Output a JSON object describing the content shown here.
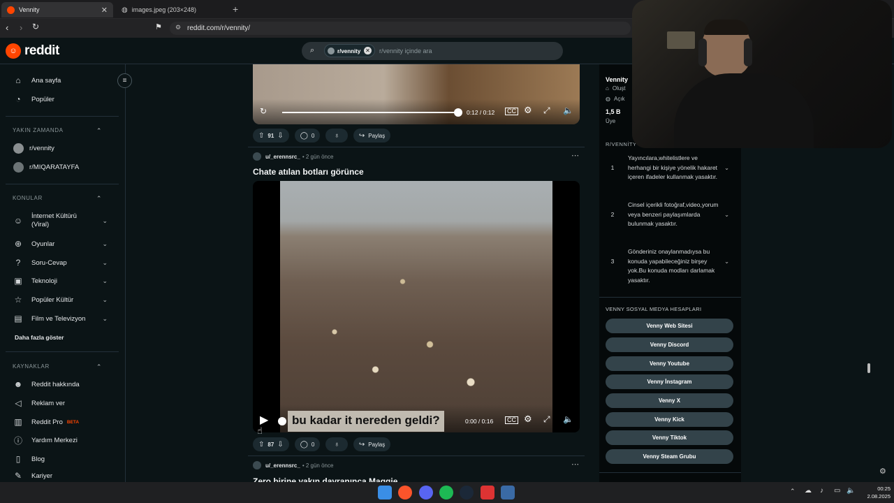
{
  "browser": {
    "tabs": [
      {
        "title": "Vennity",
        "active": true
      },
      {
        "title": "images.jpeg (203×248)",
        "active": false
      }
    ],
    "url": "reddit.com/r/vennity/"
  },
  "header": {
    "logo_text": "reddit",
    "search_chip": "r/vennity",
    "search_placeholder": "r/vennity içinde ara"
  },
  "sidebar": {
    "main": [
      {
        "label": "Ana sayfa",
        "icon": "home-icon"
      },
      {
        "label": "Popüler",
        "icon": "popular-icon"
      }
    ],
    "recent_title": "YAKIN ZAMANDA",
    "recent": [
      {
        "label": "r/vennity"
      },
      {
        "label": "r/MIQARATAYFA"
      }
    ],
    "topics_title": "KONULAR",
    "topics": [
      {
        "label": "İnternet Kültürü (Viral)",
        "icon": "smile-icon"
      },
      {
        "label": "Oyunlar",
        "icon": "gamepad-icon"
      },
      {
        "label": "Soru-Cevap",
        "icon": "question-icon"
      },
      {
        "label": "Teknoloji",
        "icon": "chip-icon"
      },
      {
        "label": "Popüler Kültür",
        "icon": "star-icon"
      },
      {
        "label": "Film ve Televizyon",
        "icon": "film-icon"
      }
    ],
    "more": "Daha fazla göster",
    "resources_title": "KAYNAKLAR",
    "resources": [
      {
        "label": "Reddit hakkında",
        "icon": "reddit-icon"
      },
      {
        "label": "Reklam ver",
        "icon": "megaphone-icon"
      },
      {
        "label": "Reddit Pro",
        "icon": "pro-icon",
        "badge": "BETA"
      },
      {
        "label": "Yardım Merkezi",
        "icon": "help-icon"
      },
      {
        "label": "Blog",
        "icon": "book-icon"
      },
      {
        "label": "Kariyer",
        "icon": "wrench-icon"
      }
    ]
  },
  "feed": {
    "top_video": {
      "time": "0:12 / 0:12",
      "progress": 1.0
    },
    "top_post_actions": {
      "votes": "91",
      "comments": "0",
      "share": "Paylaş"
    },
    "post2": {
      "author": "u/_erennsrc_",
      "time": "• 2 gün önce",
      "title": "Chate atılan botları görünce",
      "caption": "bu kadar it nereden geldi?",
      "video_time": "0:00 / 0:16",
      "progress": 0.0,
      "votes": "87",
      "comments": "0",
      "share": "Paylaş"
    },
    "post3": {
      "author": "u/_erennsrc_",
      "time": "• 2 gün önce",
      "title": "Zero birine yakın davranınca Maggie"
    }
  },
  "right": {
    "community_name": "Vennity",
    "created_partial": "Oluşt",
    "public_partial": "Açık",
    "members_value": "1,5 B",
    "members_label": "Üye",
    "rules_title": "R/VENNİTY KU",
    "rules": [
      {
        "num": "1",
        "text": "Yayıncılara,whitelistlere ve herhangi bir kişiye yönelik hakaret içeren ifadeler kullanmak yasaktır."
      },
      {
        "num": "2",
        "text": "Cinsel içerikli fotoğraf,video,yorum veya benzeri paylaşımlarda bulunmak yasaktır."
      },
      {
        "num": "3",
        "text": "Gönderiniz onaylanmadıysa bu konuda yapabileceğiniz birşey yok.Bu konuda modları darlamak yasaktır."
      }
    ],
    "social_title": "VENNY SOSYAL MEDYA HESAPLARI",
    "social": [
      "Venny Web Sitesi",
      "Venny Discord",
      "Venny Youtube",
      "Venny İnstagram",
      "Venny X",
      "Venny Kick",
      "Venny Tiktok",
      "Venny Steam Grubu"
    ]
  },
  "taskbar": {
    "time": "00:25",
    "date": "2.08.2025"
  },
  "colors": {
    "reddit_orange": "#ff4500",
    "accent_blue": "#0a4a6e",
    "bg": "#0b1416"
  }
}
